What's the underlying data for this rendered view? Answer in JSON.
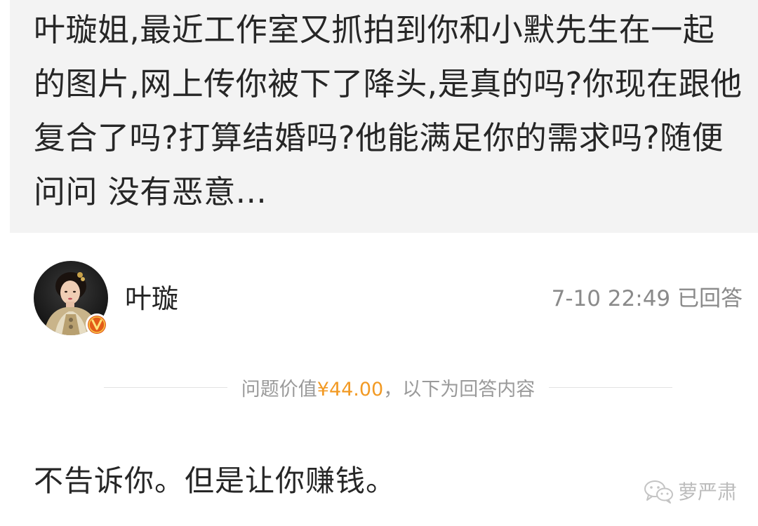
{
  "question": {
    "text": "叶璇姐,最近工作室又抓拍到你和小默先生在一起的图片,网上传你被下了降头,是真的吗?你现在跟他复合了吗?打算结婚吗?他能满足你的需求吗?随便问问 没有恶意..."
  },
  "answer": {
    "author_name": "叶璇",
    "time_status": "7-10 22:49 已回答",
    "verified_badge": "V",
    "text": "不告诉你。但是让你赚钱。"
  },
  "price_line": {
    "prefix": "问题价值",
    "amount": "¥44.00",
    "suffix": "，以下为回答内容"
  },
  "watermark": {
    "icon": "wechat-icon",
    "text": "萝严肃"
  },
  "colors": {
    "question_bg": "#f3f3f3",
    "price_accent": "#f29a24",
    "badge": "#e35b18",
    "muted_text": "#8a8a8a"
  }
}
